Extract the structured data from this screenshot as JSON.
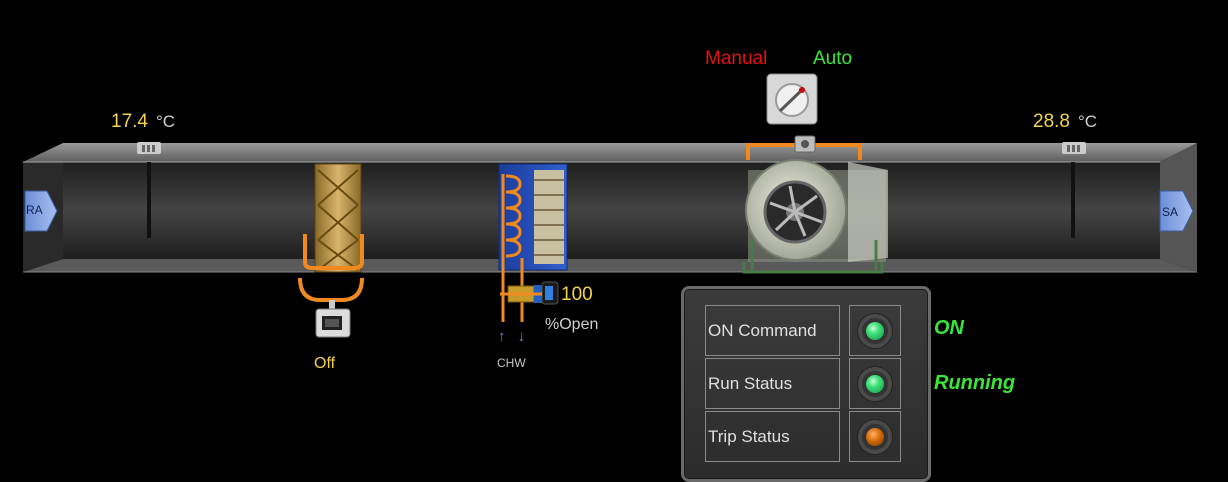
{
  "return_air": {
    "label": "RA",
    "temperature": "17.4",
    "unit": "°C"
  },
  "supply_air": {
    "label": "SA",
    "temperature": "28.8",
    "unit": "°C"
  },
  "mode_switch": {
    "manual_label": "Manual",
    "auto_label": "Auto"
  },
  "filter": {
    "status": "Off"
  },
  "chilled_water_valve": {
    "value": "100",
    "unit": "%Open",
    "label": "CHW",
    "arrows": "↑ ↓"
  },
  "status_panel": {
    "rows": [
      {
        "label": "ON Command",
        "lamp": "green"
      },
      {
        "label": "Run Status",
        "lamp": "green"
      },
      {
        "label": "Trip Status",
        "lamp": "orange"
      }
    ],
    "on_command_text": "ON",
    "run_status_text": "Running"
  },
  "colors": {
    "lamp_green": "#3fe07a",
    "lamp_orange": "#d06a08",
    "status_text": "#39e639",
    "value_text": "#f2d34a"
  }
}
